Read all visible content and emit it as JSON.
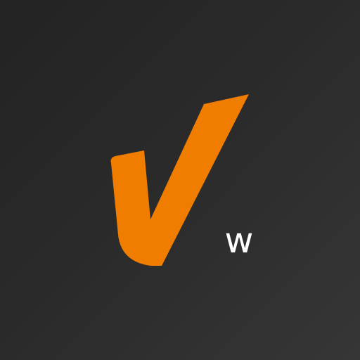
{
  "app": {
    "icon_name": "checkmark-logo-icon",
    "letter": "w"
  },
  "colors": {
    "background": "#2a2a2a",
    "accent": "#f07c00",
    "text": "#ffffff"
  }
}
